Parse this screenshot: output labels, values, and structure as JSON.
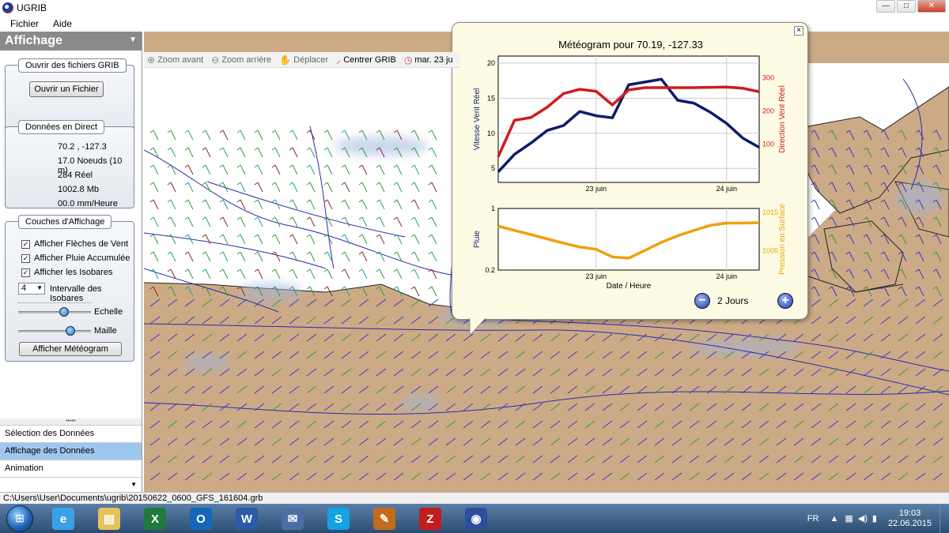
{
  "window": {
    "title": "UGRIB",
    "minimize": "—",
    "maximize": "□",
    "close": "✕"
  },
  "menu": [
    "Fichier",
    "Aide"
  ],
  "sidebar": {
    "title": "Affichage",
    "open_group": {
      "label": "Ouvrir des fichiers GRIB",
      "button": "Ouvrir un Fichier"
    },
    "live_group": {
      "label": "Données en Direct",
      "lines": [
        "70.2 ,  -127.3",
        "17.0 Noeuds (10 m)",
        "284 Réel",
        "1002.8 Mb",
        "00.0 mm/Heure"
      ]
    },
    "layers_group": {
      "label": "Couches d'Affichage",
      "checkboxes": [
        "Afficher Flèches de Vent",
        "Afficher Pluie Accumulée",
        "Afficher les Isobares"
      ],
      "isobar_interval_value": "4",
      "isobar_interval_label": "Intervalle des Isobares",
      "scale_label": "Echelle",
      "scale_level": 0.63,
      "mesh_label": "Maille",
      "mesh_level": 0.72,
      "meteogram_button": "Afficher Météogram"
    },
    "bottom_tabs": [
      "Sélection des Données",
      "Affichage des Données",
      "Animation"
    ],
    "active_tab": 1,
    "splitter": "•••••"
  },
  "toolbar": [
    {
      "icon": "zoom-in-icon",
      "label": "Zoom avant"
    },
    {
      "icon": "zoom-out-icon",
      "label": "Zoom arrière"
    },
    {
      "icon": "hand-icon",
      "label": "Déplacer"
    },
    {
      "icon": "wind-barb-icon",
      "label": "Centrer GRIB"
    },
    {
      "icon": "clock-icon",
      "label": "mar. 23 ju"
    }
  ],
  "meteogram": {
    "title": "Météogram pour 70.19, -127.33",
    "days_label": "2 Jours",
    "zoom_out": "−",
    "zoom_in": "+",
    "close": "×"
  },
  "chart_data": [
    {
      "type": "line",
      "x": [
        0,
        1,
        2,
        3,
        4,
        5,
        6,
        7,
        8,
        9,
        10,
        11,
        12,
        13,
        14,
        15,
        16,
        17,
        18,
        19,
        20,
        21,
        22,
        23,
        24,
        25,
        26,
        27,
        28,
        29,
        30,
        31,
        32,
        33,
        34,
        35,
        36,
        37,
        38,
        39,
        40,
        41,
        42,
        43,
        44,
        45,
        46,
        47,
        48
      ],
      "x_ticks": [
        {
          "pos": 18,
          "label": "23 juin"
        },
        {
          "pos": 42,
          "label": "24 juin"
        }
      ],
      "series": [
        {
          "axis": "left",
          "color": "#0c1c6b",
          "points": [
            [
              0,
              4.5
            ],
            [
              3,
              7
            ],
            [
              6,
              8.6
            ],
            [
              9,
              10.4
            ],
            [
              12,
              11.1
            ],
            [
              15,
              13.1
            ],
            [
              18,
              12.5
            ],
            [
              21,
              12.2
            ],
            [
              24,
              16.9
            ],
            [
              27,
              17.3
            ],
            [
              30,
              17.7
            ],
            [
              33,
              14.7
            ],
            [
              36,
              14.3
            ],
            [
              39,
              13
            ],
            [
              42,
              11.4
            ],
            [
              45,
              9.3
            ],
            [
              48,
              8
            ]
          ]
        },
        {
          "axis": "right",
          "color": "#d11b1b",
          "points": [
            [
              0,
              62
            ],
            [
              3,
              172
            ],
            [
              6,
              180
            ],
            [
              9,
              211
            ],
            [
              12,
              252
            ],
            [
              15,
              265
            ],
            [
              18,
              259
            ],
            [
              21,
              218
            ],
            [
              24,
              263
            ],
            [
              27,
              270
            ],
            [
              30,
              270
            ],
            [
              33,
              270
            ],
            [
              36,
              270
            ],
            [
              39,
              271
            ],
            [
              42,
              272
            ],
            [
              45,
              268
            ],
            [
              48,
              258
            ]
          ]
        }
      ],
      "ylabel": "Vitesse Vent Réel",
      "ylabel_right": "Direction Vent Réel",
      "ylim": [
        3,
        21
      ],
      "yticks": [
        5,
        10,
        15,
        20
      ],
      "ylim_right": [
        -15,
        365
      ],
      "yticks_right": [
        100,
        200,
        300
      ],
      "grid": true
    },
    {
      "type": "line",
      "x_ticks": [
        {
          "pos": 18,
          "label": "23 juin"
        },
        {
          "pos": 42,
          "label": "24 juin"
        }
      ],
      "xlabel": "Date / Heure",
      "series": [
        {
          "axis": "right",
          "color": "#f0a00c",
          "points": [
            [
              0,
              1011.4
            ],
            [
              3,
              1010.3
            ],
            [
              6,
              1009.2
            ],
            [
              9,
              1008.1
            ],
            [
              12,
              1007.0
            ],
            [
              15,
              1006.0
            ],
            [
              18,
              1005.4
            ],
            [
              21,
              1003.4
            ],
            [
              24,
              1003.1
            ],
            [
              27,
              1005.1
            ],
            [
              30,
              1007.2
            ],
            [
              33,
              1008.9
            ],
            [
              36,
              1010.3
            ],
            [
              39,
              1011.6
            ],
            [
              42,
              1012.2
            ],
            [
              45,
              1012.2
            ],
            [
              48,
              1012.3
            ]
          ]
        }
      ],
      "ylabel": "Pluie",
      "ylabel_right": "Pression en Surface",
      "ylim": [
        0.2,
        1
      ],
      "yticks": [
        0.2,
        1
      ],
      "ylim_right": [
        1000,
        1016
      ],
      "yticks_right": [
        1005,
        1015
      ],
      "grid": true
    }
  ],
  "status_bar": "C:\\Users\\User\\Documents\\ugrib\\20150622_0600_GFS_161604.grb",
  "taskbar": {
    "apps": [
      {
        "name": "internet-explorer",
        "glyph": "e",
        "color": "#3aa0e8"
      },
      {
        "name": "file-explorer",
        "glyph": "▤",
        "color": "#e7c25a"
      },
      {
        "name": "excel",
        "glyph": "X",
        "color": "#1f7a3c"
      },
      {
        "name": "outlook",
        "glyph": "O",
        "color": "#1767b8"
      },
      {
        "name": "word",
        "glyph": "W",
        "color": "#2a5aa8"
      },
      {
        "name": "thunderbird",
        "glyph": "✉",
        "color": "#4a6fa5"
      },
      {
        "name": "skype",
        "glyph": "S",
        "color": "#13a3e0"
      },
      {
        "name": "pen-tool",
        "glyph": "✎",
        "color": "#c46a1a"
      },
      {
        "name": "filezilla",
        "glyph": "Z",
        "color": "#c21d1d"
      },
      {
        "name": "ugrib",
        "glyph": "◉",
        "color": "#2c4f9c"
      }
    ],
    "language": "FR",
    "time": "19:03",
    "date": "22.06.2015"
  }
}
